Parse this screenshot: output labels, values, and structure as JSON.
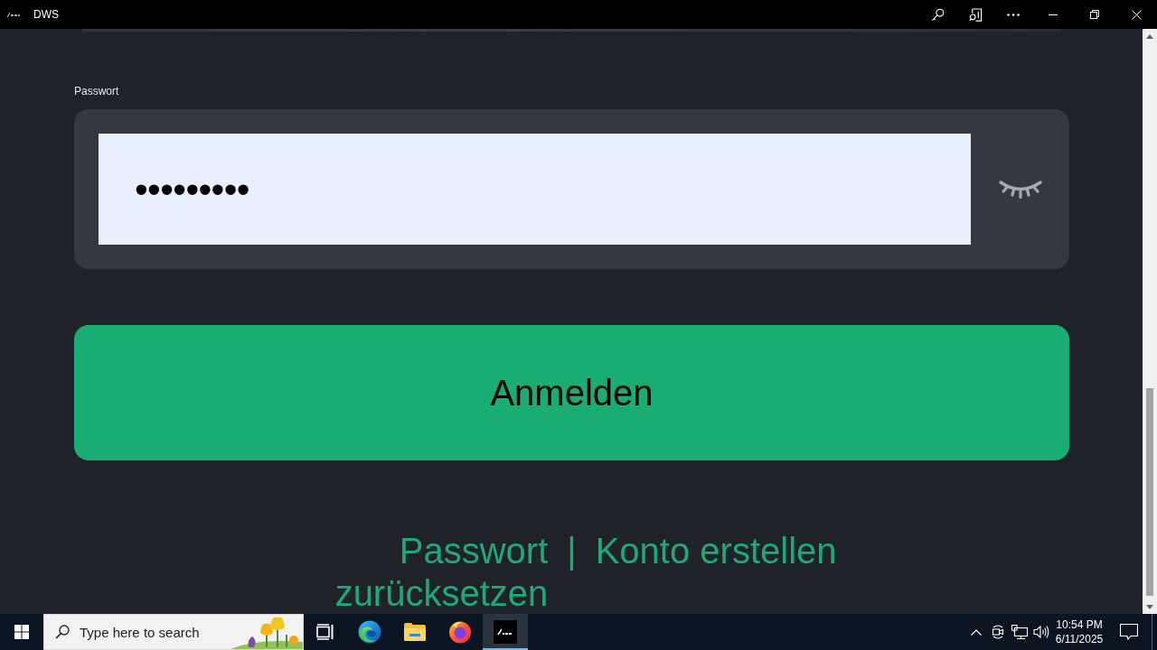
{
  "window": {
    "title": "DWS"
  },
  "form": {
    "field_label": "Passwort",
    "password": {
      "value": "•••••••••",
      "revealed": false
    },
    "submit_button": "Anmelden"
  },
  "links": {
    "items": [
      {
        "label": "Passwort zurücksetzen"
      },
      {
        "label": "Konto erstellen"
      }
    ],
    "separator": "|"
  },
  "taskbar": {
    "search": {
      "placeholder": "Type here to search"
    },
    "apps": [
      {
        "kind": "task-view",
        "selected": false
      },
      {
        "kind": "edge",
        "selected": false
      },
      {
        "kind": "explorer",
        "selected": false
      },
      {
        "kind": "firefox",
        "selected": false
      },
      {
        "kind": "dws",
        "selected": true
      }
    ],
    "clock": {
      "time": "10:54 PM",
      "date": "6/11/2025"
    }
  }
}
